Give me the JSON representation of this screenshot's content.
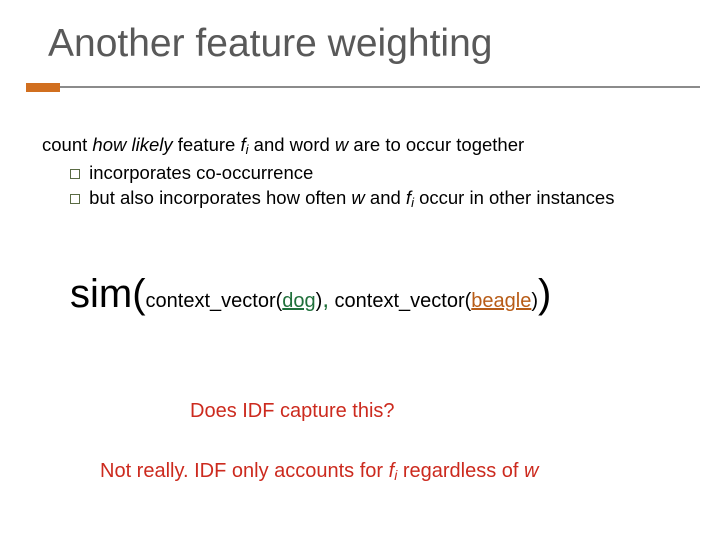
{
  "title": "Another feature weighting",
  "body": {
    "line1_a": "count ",
    "line1_b": "how likely",
    "line1_c": " feature ",
    "fi_f": "f",
    "fi_i": "i",
    "line1_d": " and word ",
    "w": "w",
    "line1_e": " are to occur together",
    "sub1": " incorporates co-occurrence",
    "sub2_a": " but also incorporates how often ",
    "sub2_b": " and ",
    "sub2_c": " occur in other instances"
  },
  "sim": {
    "func": "sim(",
    "cv": "context_vector(",
    "word1": "dog",
    "close1": ")",
    "comma": ",",
    "space": "  ",
    "word2": "beagle",
    "close2": ")",
    "close3": ")"
  },
  "question": "Does IDF capture this?",
  "answer": {
    "a": "Not really.  IDF only accounts for ",
    "b": " regardless of "
  }
}
